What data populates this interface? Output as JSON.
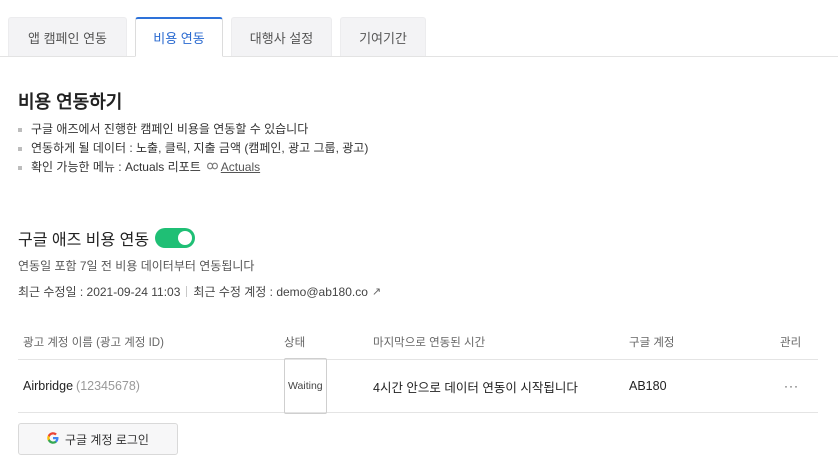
{
  "tabs": [
    {
      "label": "앱 캠페인 연동"
    },
    {
      "label": "비용 연동"
    },
    {
      "label": "대행사 설정"
    },
    {
      "label": "기여기간"
    }
  ],
  "section": {
    "title": "비용 연동하기",
    "bullets": [
      "구글 애즈에서 진행한 캠페인 비용을 연동할 수 있습니다",
      "연동하게 될 데이터 : 노출, 클릭, 지출 금액 (캠페인, 광고 그룹, 광고)",
      "확인 가능한 메뉴 : Actuals 리포트"
    ],
    "link_label": "Actuals"
  },
  "google_ads": {
    "title": "구글 애즈 비용 연동",
    "toggle_on": true,
    "description": "연동일 포함 7일 전 비용 데이터부터 연동됩니다",
    "last_modified": "최근 수정일 : 2021-09-24 11:03",
    "modified_by": "최근 수정 계정 : demo@ab180.co"
  },
  "table": {
    "headers": [
      "광고 계정 이름 (광고 계정 ID)",
      "상태",
      "마지막으로 연동된 시간",
      "구글 계정",
      "관리"
    ],
    "rows": [
      {
        "name": "Airbridge",
        "id": "(12345678)",
        "status": "Waiting",
        "last_sync": "4시간 안으로 데이터 연동이 시작됩니다",
        "google_account": "AB180",
        "manage": "···"
      }
    ]
  },
  "login_button": {
    "icon": "G",
    "label": "구글 계정 로그인"
  },
  "colors": {
    "accent": "#2e72d9",
    "toggle": "#1fbf75",
    "google_blue": "#4285f4"
  }
}
